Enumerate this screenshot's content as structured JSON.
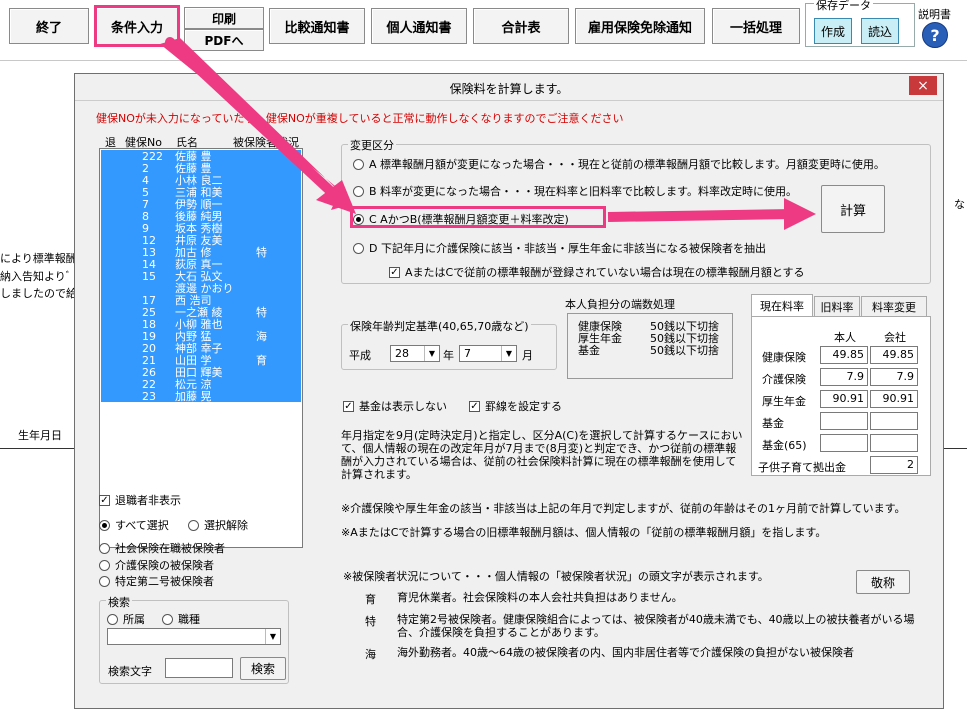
{
  "toolbar": {
    "end": "終了",
    "input": "条件入力",
    "print": "印刷",
    "pdf": "PDFへ",
    "compare": "比較通知書",
    "personal": "個人通知書",
    "total": "合計表",
    "exempt": "雇用保険免除通知",
    "batch": "一括処理",
    "save_group": "保存データ",
    "create": "作成",
    "load": "読込",
    "manual": "説明書",
    "help_icon": "?"
  },
  "background": {
    "line1": "により標準報酬",
    "line2": "納入告知よりﾞ",
    "line3": "しましたので給",
    "birth": "生年月日",
    "right_partial": "な"
  },
  "dialog": {
    "title": "保険料を計算します。",
    "close": "×",
    "warning": "健保NOが未入力になっていたり、健保NOが重複していると正常に動作しなくなりますのでご注意ください",
    "list_headers": [
      "退",
      "健保No",
      "氏名",
      "被保険者状況"
    ],
    "employees": [
      {
        "no": "222",
        "name": "佐藤 豊",
        "status": ""
      },
      {
        "no": "2",
        "name": "佐藤 豊",
        "status": ""
      },
      {
        "no": "4",
        "name": "小林 良二",
        "status": ""
      },
      {
        "no": "5",
        "name": "三浦 和美",
        "status": ""
      },
      {
        "no": "7",
        "name": "伊勢 順一",
        "status": ""
      },
      {
        "no": "8",
        "name": "後藤 純男",
        "status": ""
      },
      {
        "no": "9",
        "name": "坂本 秀樹",
        "status": ""
      },
      {
        "no": "12",
        "name": "井原 友美",
        "status": ""
      },
      {
        "no": "13",
        "name": "加古 修",
        "status": "特"
      },
      {
        "no": "14",
        "name": "荻原 真一",
        "status": ""
      },
      {
        "no": "15",
        "name": "大石 弘文",
        "status": ""
      },
      {
        "no": "",
        "name": "渡邊 かおり",
        "status": ""
      },
      {
        "no": "17",
        "name": "西 浩司",
        "status": ""
      },
      {
        "no": "25",
        "name": "一之瀬 綾",
        "status": "特"
      },
      {
        "no": "18",
        "name": "小柳 雅也",
        "status": ""
      },
      {
        "no": "19",
        "name": "内野 猛",
        "status": "海"
      },
      {
        "no": "20",
        "name": "神部 幸子",
        "status": ""
      },
      {
        "no": "21",
        "name": "山田 学",
        "status": "育"
      },
      {
        "no": "26",
        "name": "田口 輝美",
        "status": ""
      },
      {
        "no": "22",
        "name": "松元 涼",
        "status": ""
      },
      {
        "no": "23",
        "name": "加藤 晃",
        "status": ""
      }
    ],
    "hide_retired": "退職者非表示",
    "select_all": "すべて選択",
    "deselect": "選択解除",
    "filter_social": "社会保険在職被保険者",
    "filter_care": "介護保険の被保険者",
    "filter_special": "特定第二号被保険者",
    "search_group": "検索",
    "search_dept": "所属",
    "search_job": "職種",
    "search_text_label": "検索文字",
    "search_text_value": "",
    "search_button": "検索",
    "change_group": "変更区分",
    "option_a": "A 標準報酬月額が変更になった場合・・・現在と従前の標準報酬月額で比較します。月額変更時に使用。",
    "option_b": "B 料率が変更になった場合・・・現在料率と旧料率で比較します。料率改定時に使用。",
    "option_c": "C AかつB(標準報酬月額変更＋料率改定)",
    "option_d": "D 下記年月に介護保険に該当・非該当・厚生年金に非該当になる被保険者を抽出",
    "option_d_check": "AまたはCで従前の標準報酬が登録されていない場合は現在の標準報酬月額とする",
    "calc_button": "計算",
    "age_group": "保険年齢判定基準(40,65,70歳など)",
    "era": "平成",
    "year_value": "28",
    "year_unit": "年",
    "month_value": "7",
    "month_unit": "月",
    "rounding_title": "本人負担分の端数処理",
    "rounding": [
      {
        "name": "健康保険",
        "rule": "50銭以下切捨"
      },
      {
        "name": "厚生年金",
        "rule": "50銭以下切捨"
      },
      {
        "name": "基金",
        "rule": "50銭以下切捨"
      }
    ],
    "fund_hidden": "基金は表示しない",
    "ruled_lines": "罫線を設定する",
    "note_year": "年月指定を9月(定時決定月)と指定し、区分A(C)を選択して計算するケースにおいて、個人情報の現在の改定年月が7月まで(8月変)と判定でき、かつ従前の標準報酬が入力されている場合は、従前の社会保険料計算に現在の標準報酬を使用して計算されます。",
    "note_care": "※介護保険や厚生年金の該当・非該当は上記の年月で判定しますが、従前の年齢はその1ヶ月前で計算しています。",
    "note_prev": "※AまたはCで計算する場合の旧標準報酬月額は、個人情報の「従前の標準報酬月額」を指します。",
    "tabs": [
      "現在料率",
      "旧料率",
      "料率変更"
    ],
    "rate_headers": [
      "本人",
      "会社"
    ],
    "rates": [
      {
        "name": "健康保険",
        "self": "49.85",
        "company": "49.85"
      },
      {
        "name": "介護保険",
        "self": "7.9",
        "company": "7.9"
      },
      {
        "name": "厚生年金",
        "self": "90.91",
        "company": "90.91"
      },
      {
        "name": "基金",
        "self": "",
        "company": ""
      },
      {
        "name": "基金(65)",
        "self": "",
        "company": ""
      }
    ],
    "childcare_label": "子供子育て拠出金",
    "childcare_value": "2",
    "status_note": "※被保険者状況について・・・個人情報の「被保険者状況」の頭文字が表示されます。",
    "honorific_button": "敬称",
    "legend": [
      {
        "mark": "育",
        "text": "育児休業者。社会保険料の本人会社共負担はありません。"
      },
      {
        "mark": "特",
        "text": "特定第2号被保険者。健康保険組合によっては、被保険者が40歳未満でも、40歳以上の被扶養者がいる場合、介護保険を負担することがあります。"
      },
      {
        "mark": "海",
        "text": "海外勤務者。40歳～64歳の被保険者の内、国内非居住者等で介護保険の負担がない被保険者"
      }
    ]
  },
  "colors": {
    "highlight": "#ee3a82",
    "selection": "#3399ff",
    "warning": "#d60000",
    "close": "#c7393a"
  }
}
